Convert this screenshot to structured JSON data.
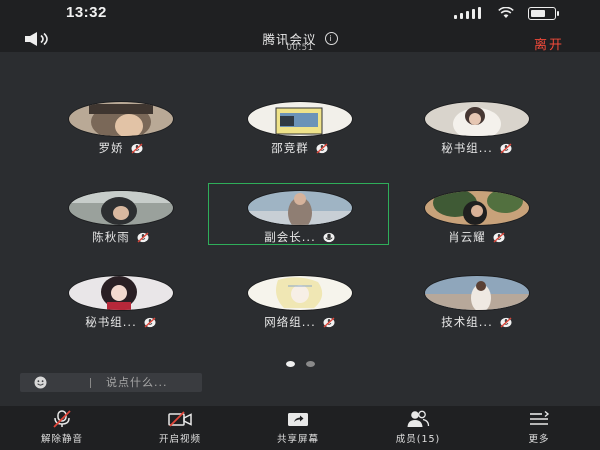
{
  "status_bar": {
    "time": "13:32"
  },
  "header": {
    "title": "腾讯会议",
    "timer": "00:51",
    "leave_label": "离开"
  },
  "participants": [
    {
      "name": "罗娇",
      "avatar": "avatar-boy-profile"
    },
    {
      "name": "邵竞群",
      "avatar": "avatar-card-photo"
    },
    {
      "name": "秘书组...",
      "avatar": "avatar-girl-white"
    },
    {
      "name": "陈秋雨",
      "avatar": "avatar-helmet-person"
    },
    {
      "name": "副会长...",
      "avatar": "avatar-woman-seated",
      "selected": true,
      "speaking": true
    },
    {
      "name": "肖云耀",
      "avatar": "avatar-person-plants"
    },
    {
      "name": "秘书组...",
      "avatar": "avatar-anime-girl-red"
    },
    {
      "name": "网络组...",
      "avatar": "avatar-anime-sketch"
    },
    {
      "name": "技术组...",
      "avatar": "avatar-girl-sunset"
    }
  ],
  "pagination": {
    "pages": 2,
    "active": 0
  },
  "chat": {
    "placeholder": "说点什么..."
  },
  "toolbar": {
    "unmute_label": "解除静音",
    "video_label": "开启视频",
    "share_label": "共享屏幕",
    "members_label": "成员(15)",
    "more_label": "更多"
  },
  "colors": {
    "background": "#2b2d30",
    "bars": "#1f2022",
    "leave": "#f04a3a",
    "selected_frame": "#2fae5a",
    "muted_icon": "#e0463a"
  }
}
